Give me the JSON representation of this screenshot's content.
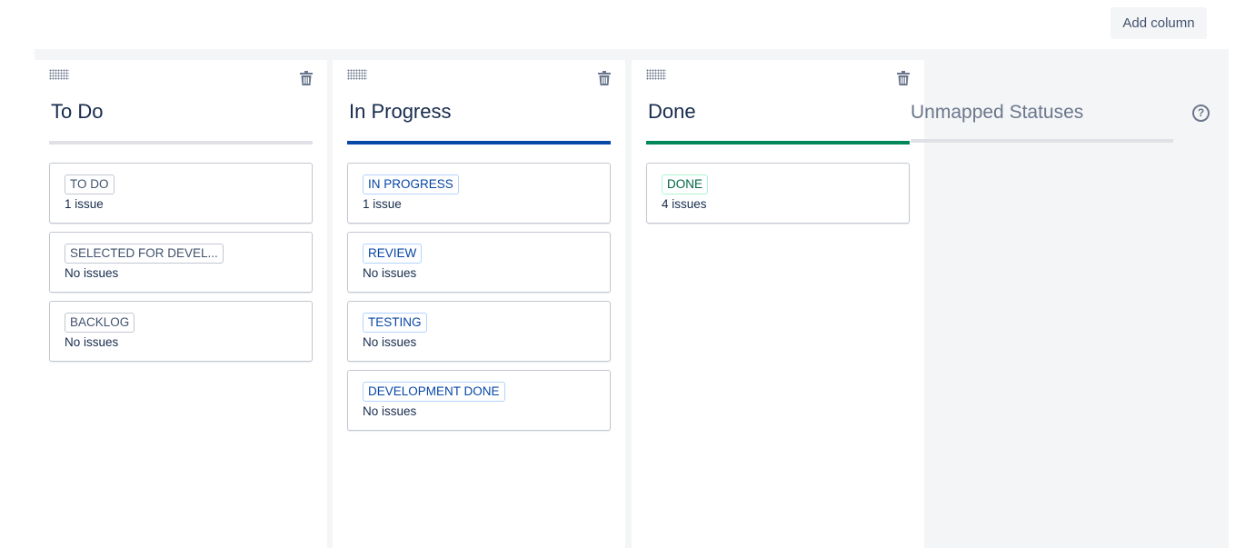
{
  "toolbar": {
    "add_column_label": "Add column"
  },
  "columns": [
    {
      "title": "To Do",
      "statuses": [
        {
          "label": "TO DO",
          "count": "1 issue"
        },
        {
          "label": "SELECTED FOR DEVEL...",
          "count": "No issues"
        },
        {
          "label": "BACKLOG",
          "count": "No issues"
        }
      ]
    },
    {
      "title": "In Progress",
      "statuses": [
        {
          "label": "IN PROGRESS",
          "count": "1 issue"
        },
        {
          "label": "REVIEW",
          "count": "No issues"
        },
        {
          "label": "TESTING",
          "count": "No issues"
        },
        {
          "label": "DEVELOPMENT DONE",
          "count": "No issues"
        }
      ]
    },
    {
      "title": "Done",
      "statuses": [
        {
          "label": "DONE",
          "count": "4 issues"
        }
      ]
    }
  ],
  "unmapped": {
    "title": "Unmapped Statuses",
    "help_icon": "question-circle-icon",
    "help_glyph": "?"
  },
  "colors": {
    "todo_bar": "#dfe1e6",
    "inprogress_bar": "#0747a6",
    "done_bar": "#00875a",
    "unmapped_bg": "#f4f5f7"
  }
}
